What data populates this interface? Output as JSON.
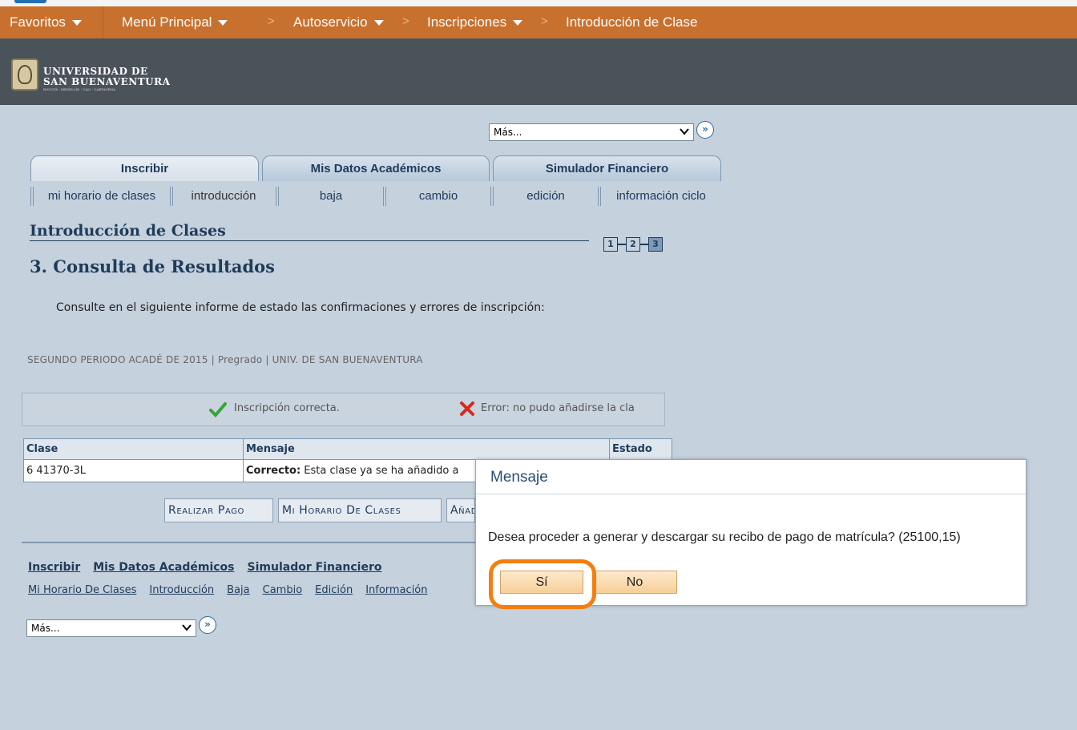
{
  "nav": {
    "favorites": "Favoritos",
    "main_menu": "Menú Principal",
    "self_service": "Autoservicio",
    "enrollment": "Inscripciones",
    "current": "Introducción de Clase",
    "separator": ">"
  },
  "logo": {
    "line1": "UNIVERSIDAD DE",
    "line2": "SAN BUENAVENTURA",
    "line3": "BOGOTÁ · MEDELLÍN · CALI · CARTAGENA"
  },
  "top_select": {
    "value": "Más..."
  },
  "tabs": [
    {
      "label": "Inscribir",
      "active": true
    },
    {
      "label": "Mis Datos Académicos",
      "active": false
    },
    {
      "label": "Simulador Financiero",
      "active": false
    }
  ],
  "subtabs": [
    {
      "label": "mi horario de clases"
    },
    {
      "label": "introducción"
    },
    {
      "label": "baja"
    },
    {
      "label": "cambio"
    },
    {
      "label": "edición"
    },
    {
      "label": "información ciclo"
    }
  ],
  "page": {
    "title": "Introducción de Clases",
    "steps": [
      "1",
      "2",
      "3"
    ],
    "step_title": "3. Consulta de Resultados",
    "instruction": "Consulte en el siguiente informe de estado las confirmaciones y errores de inscripción:",
    "period": "SEGUNDO PERIODO ACADÉ DE 2015 | Pregrado | UNIV. DE SAN BUENAVENTURA"
  },
  "legend": {
    "ok": "Inscripción correcta.",
    "error": "Error: no pudo añadirse la cla"
  },
  "table": {
    "headers": [
      "Clase",
      "Mensaje",
      "Estado"
    ],
    "rows": [
      {
        "clase": "6 41370-3L",
        "mensaje_bold": "Correcto:",
        "mensaje": " Esta clase ya se ha añadido a",
        "estado": ""
      }
    ]
  },
  "actions": {
    "pay": "Realizar Pago",
    "schedule": "Mi Horario De Clases",
    "add": "Añadir"
  },
  "bottom_links": {
    "primary": [
      "Inscribir",
      "Mis Datos Académicos",
      "Simulador Financiero"
    ],
    "secondary": [
      "Mi Horario De Clases",
      "Introducción",
      "Baja",
      "Cambio",
      "Edición",
      "Información"
    ]
  },
  "bottom_select": {
    "value": "Más..."
  },
  "modal": {
    "title": "Mensaje",
    "message": "Desea proceder a generar y descargar su recibo de pago de matrícula? (25100,15)",
    "yes": "Sí",
    "no": "No"
  },
  "colors": {
    "nav_bg": "#c8702e",
    "banner_bg": "#4a525a",
    "page_bg": "#c5d1dd",
    "highlight": "#f57e10"
  }
}
